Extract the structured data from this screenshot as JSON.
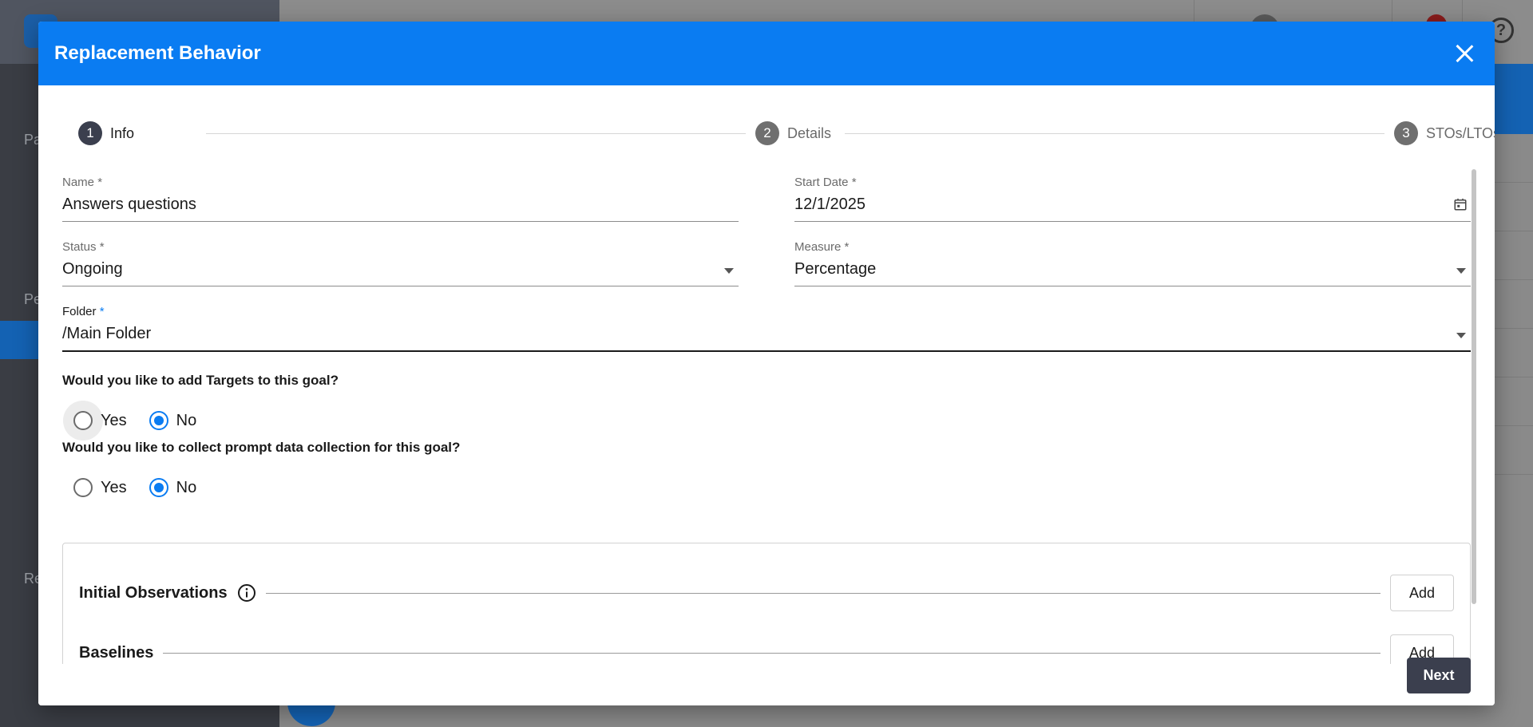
{
  "modal": {
    "title": "Replacement Behavior",
    "next_label": "Next"
  },
  "stepper": {
    "steps": [
      {
        "number": "1",
        "label": "Info",
        "state": "active"
      },
      {
        "number": "2",
        "label": "Details",
        "state": "inactive"
      },
      {
        "number": "3",
        "label": "STOs/LTOs",
        "state": "inactive"
      }
    ]
  },
  "form": {
    "name": {
      "label": "Name",
      "required": "*",
      "value": "Answers questions"
    },
    "start_date": {
      "label": "Start Date",
      "required": "*",
      "value": "12/1/2025"
    },
    "status": {
      "label": "Status",
      "required": "*",
      "value": "Ongoing"
    },
    "measure": {
      "label": "Measure",
      "required": "*",
      "value": "Percentage"
    },
    "folder": {
      "label": "Folder",
      "required": "*",
      "value": "/Main Folder"
    }
  },
  "questions": {
    "targets": {
      "text": "Would you like to add Targets to this goal?",
      "options": [
        "Yes",
        "No"
      ],
      "selected": "No"
    },
    "prompt": {
      "text": "Would you like to collect prompt data collection for this goal?",
      "options": [
        "Yes",
        "No"
      ],
      "selected": "No"
    }
  },
  "sections": {
    "initial_observations": {
      "title": "Initial Observations",
      "add_label": "Add"
    },
    "baselines": {
      "title": "Baselines",
      "add_label": "Add"
    }
  },
  "background": {
    "sidebar_items": [
      "Pa",
      "Pe",
      "Re"
    ]
  },
  "colors": {
    "accent": "#0a7cf2",
    "dark_button": "#3b3f4e"
  }
}
